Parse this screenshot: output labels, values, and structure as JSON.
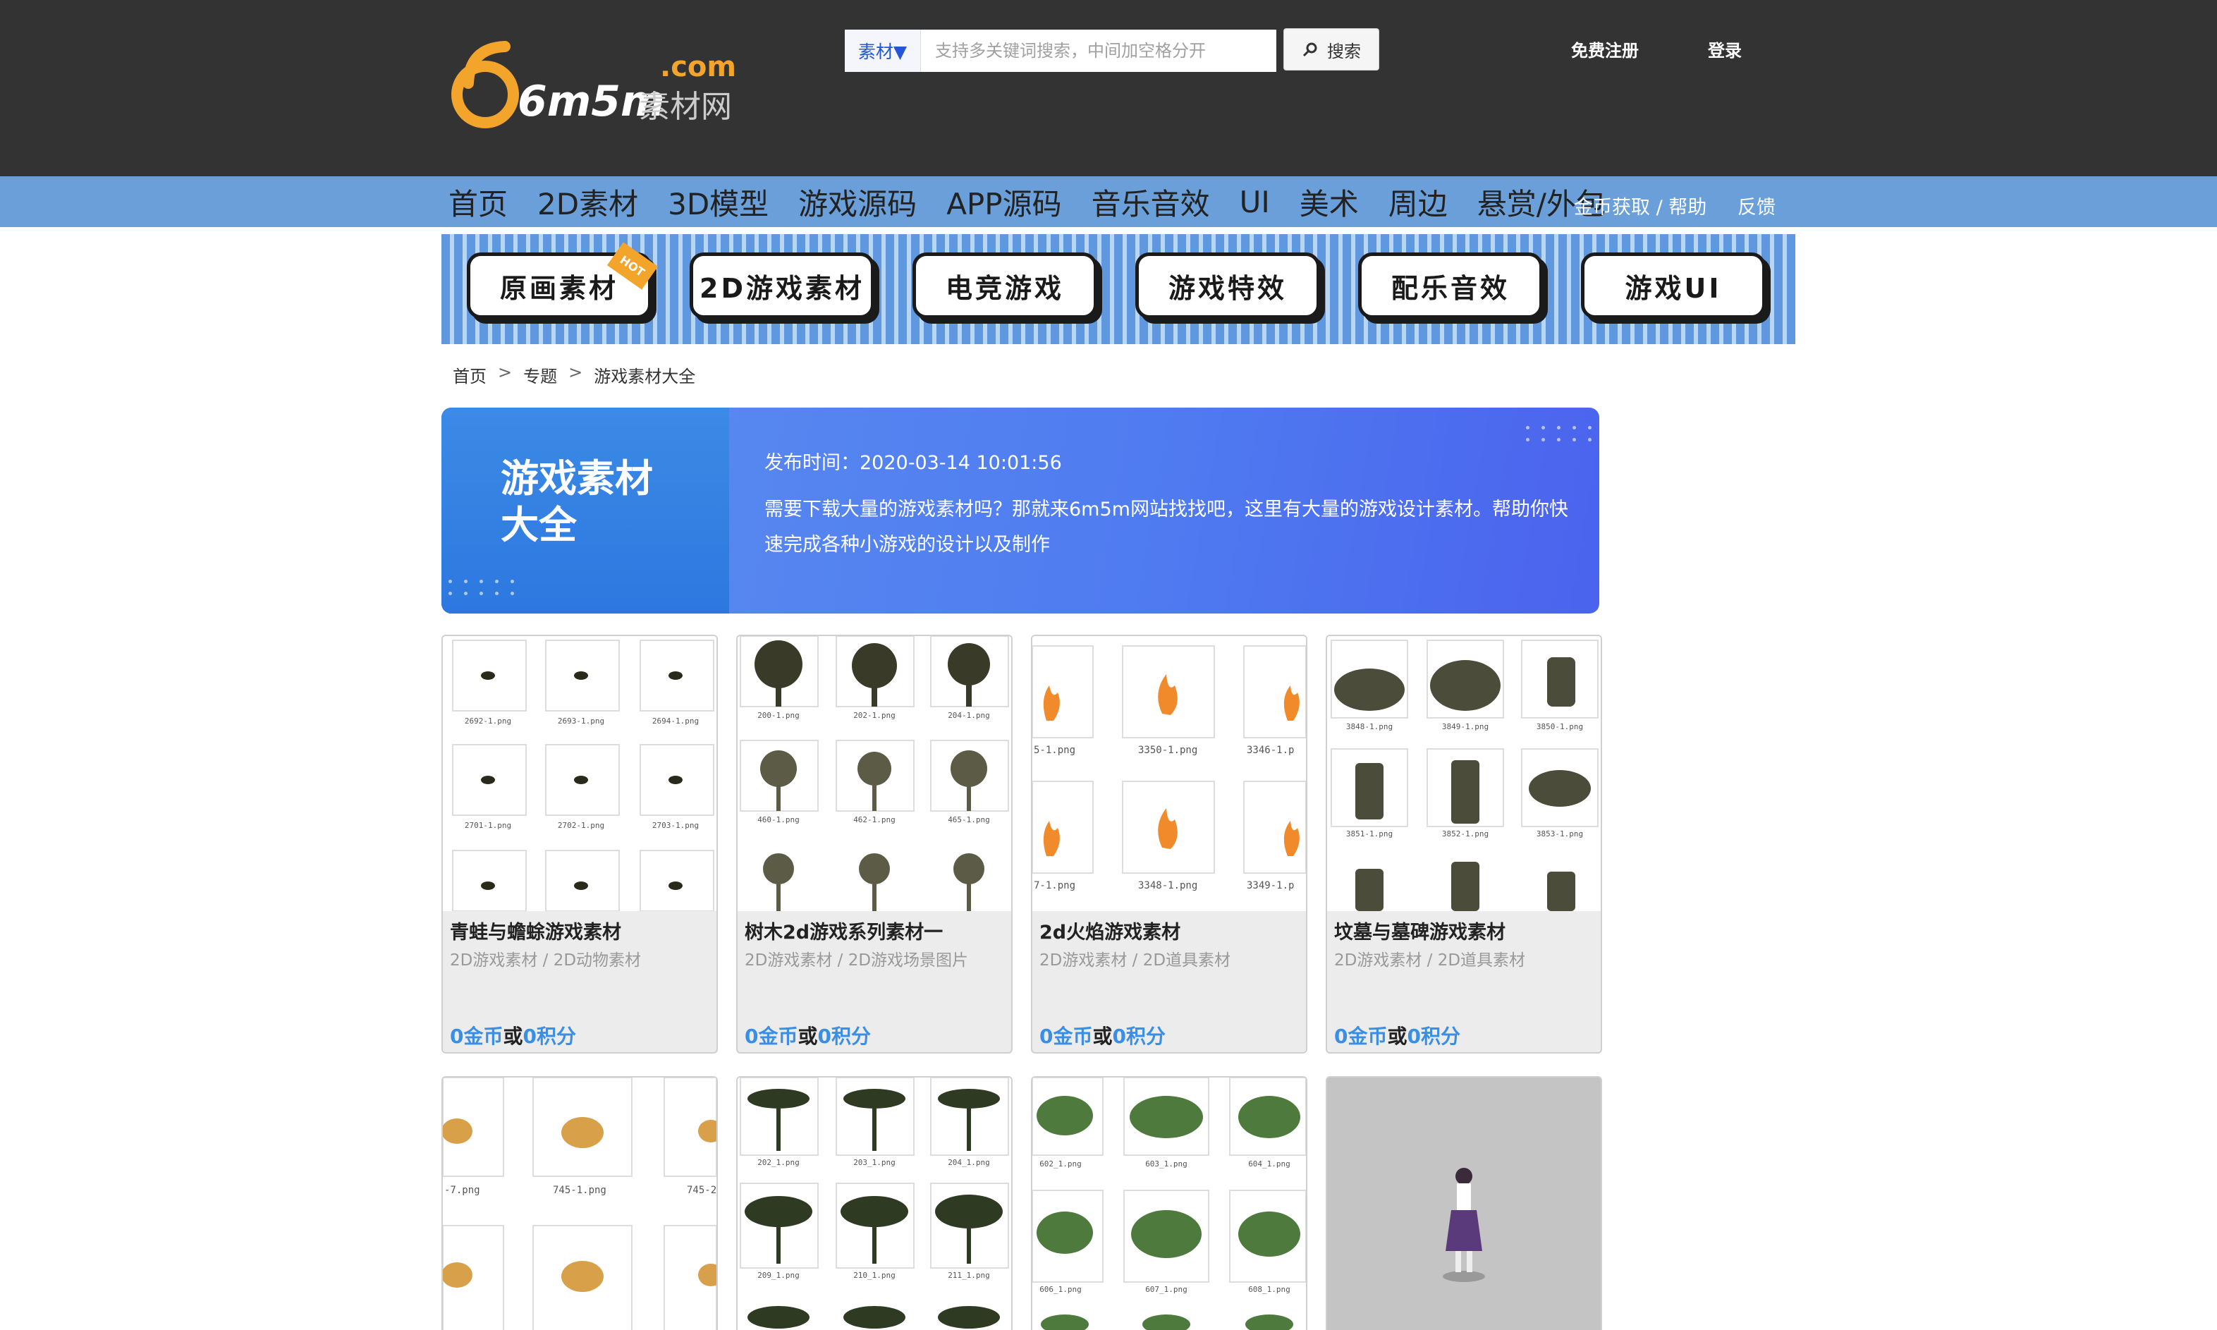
{
  "header": {
    "logo_text": "6m5m",
    "logo_com": ".com",
    "logo_cn": "素材网",
    "search_category": "素材▼",
    "search_placeholder": "支持多关键词搜索，中间加空格分开",
    "search_button": "搜索",
    "register": "免费注册",
    "login": "登录"
  },
  "nav": {
    "items": [
      "首页",
      "2D素材",
      "3D模型",
      "游戏源码",
      "APP源码",
      "音乐音效",
      "UI",
      "美术",
      "周边",
      "悬赏/外包"
    ],
    "help": "金币获取 / 帮助",
    "feedback": "反馈"
  },
  "strip": {
    "buttons": [
      "原画素材",
      "2D游戏素材",
      "电竞游戏",
      "游戏特效",
      "配乐音效",
      "游戏UI"
    ],
    "hot_tag": "HOT"
  },
  "breadcrumb": {
    "home": "首页",
    "sep": ">",
    "topic": "专题",
    "current": "游戏素材大全"
  },
  "topic": {
    "title": "游戏素材大全",
    "date": "发布时间：2020-03-14 10:01:56",
    "desc": "需要下载大量的游戏素材吗？那就来6m5m网站找找吧，这里有大量的游戏设计素材。帮助你快速完成各种小游戏的设计以及制作"
  },
  "cards": [
    {
      "title": "青蛙与蟾蜍游戏素材",
      "category": "2D游戏素材 / 2D动物素材",
      "coins": "0金币",
      "or": "或",
      "points": "0积分",
      "labels": [
        "2692-1.png",
        "2693-1.png",
        "2694-1.png",
        "2701-1.png",
        "2702-1.png",
        "2703-1.png"
      ]
    },
    {
      "title": "树木2d游戏系列素材一",
      "category": "2D游戏素材 / 2D游戏场景图片",
      "coins": "0金币",
      "or": "或",
      "points": "0积分",
      "labels": [
        "200-1.png",
        "202-1.png",
        "204-1.png",
        "460-1.png",
        "462-1.png",
        "465-1.png"
      ]
    },
    {
      "title": "2d火焰游戏素材",
      "category": "2D游戏素材 / 2D道具素材",
      "coins": "0金币",
      "or": "或",
      "points": "0积分",
      "labels": [
        "5-1.png",
        "3350-1.png",
        "3346-1.p",
        "7-1.png",
        "3348-1.png",
        "3349-1.p"
      ]
    },
    {
      "title": "坟墓与墓碑游戏素材",
      "category": "2D游戏素材 / 2D道具素材",
      "coins": "0金币",
      "or": "或",
      "points": "0积分",
      "labels": [
        "3848-1.png",
        "3849-1.png",
        "3850-1.png",
        "3851-1.png",
        "3852-1.png",
        "3853-1.png"
      ]
    }
  ],
  "cards_row2": [
    {
      "labels": [
        "-7.png",
        "745-1.png",
        "745-2"
      ]
    },
    {
      "labels": [
        "202_1.png",
        "203_1.png",
        "204_1.png",
        "209_1.png",
        "210_1.png",
        "211_1.png"
      ]
    },
    {
      "labels": [
        "602_1.png",
        "603_1.png",
        "604_1.png",
        "606_1.png",
        "607_1.png",
        "608_1.png"
      ]
    },
    {
      "labels": []
    }
  ],
  "colors": {
    "header_bg": "#333333",
    "nav_bg": "#6a9fd9",
    "accent_blue": "#3a8ee6",
    "logo_orange": "#f2a42b"
  }
}
